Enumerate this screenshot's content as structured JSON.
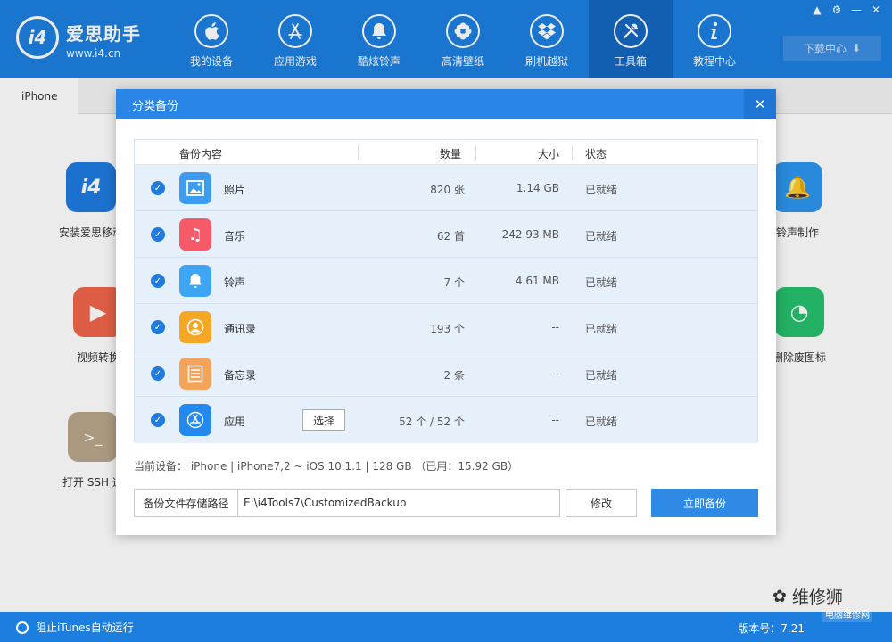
{
  "app": {
    "brand_name": "爱思助手",
    "brand_url": "www.i4.cn",
    "logo_text": "i4",
    "download_label": "下载中心"
  },
  "nav": [
    {
      "label": "我的设备",
      "icon": "apple-icon"
    },
    {
      "label": "应用游戏",
      "icon": "app-store-icon"
    },
    {
      "label": "酷炫铃声",
      "icon": "bell-icon"
    },
    {
      "label": "高清壁纸",
      "icon": "flower-icon"
    },
    {
      "label": "刷机越狱",
      "icon": "dropbox-icon"
    },
    {
      "label": "工具箱",
      "icon": "tools-icon"
    },
    {
      "label": "教程中心",
      "icon": "info-icon"
    }
  ],
  "tabs": {
    "device": "iPhone"
  },
  "background_tools": [
    {
      "label": "安装爱思移动",
      "color": "#1f7be0"
    },
    {
      "label": "视频转换",
      "color": "#f0654a"
    },
    {
      "label": "打开 SSH 通",
      "color": "#b9a58a"
    },
    {
      "label": "铃声制作",
      "color": "#2d96ee"
    },
    {
      "label": "删除废图标",
      "color": "#25c06d"
    }
  ],
  "dialog": {
    "title": "分类备份",
    "columns": {
      "content": "备份内容",
      "count": "数量",
      "size": "大小",
      "status": "状态"
    },
    "rows": [
      {
        "name": "照片",
        "count": "820 张",
        "size": "1.14 GB",
        "status": "已就绪",
        "color": "#3d9cf0",
        "icon": "photo-icon"
      },
      {
        "name": "音乐",
        "count": "62 首",
        "size": "242.93 MB",
        "status": "已就绪",
        "color": "#f65a68",
        "icon": "music-icon"
      },
      {
        "name": "铃声",
        "count": "7 个",
        "size": "4.61 MB",
        "status": "已就绪",
        "color": "#3ea4f4",
        "icon": "bell-icon"
      },
      {
        "name": "通讯录",
        "count": "193 个",
        "size": "--",
        "status": "已就绪",
        "color": "#f5a623",
        "icon": "contacts-icon"
      },
      {
        "name": "备忘录",
        "count": "2 条",
        "size": "--",
        "status": "已就绪",
        "color": "#f3a35a",
        "icon": "notes-icon"
      },
      {
        "name": "应用",
        "count": "52 个 / 52 个",
        "size": "--",
        "status": "已就绪",
        "color": "#2489ec",
        "icon": "app-store-icon",
        "select_label": "选择"
      }
    ],
    "device_info": "当前设备： iPhone   |   iPhone7,2 ~ iOS 10.1.1   |   128 GB （已用：15.92 GB）",
    "path_label": "备份文件存储路径",
    "path_value": "E:\\i4Tools7\\CustomizedBackup",
    "modify_label": "修改",
    "backup_label": "立即备份"
  },
  "statusbar": {
    "itunes_label": "阻止iTunes自动运行",
    "version": "版本号：7.21"
  },
  "watermark": {
    "text": "维修狮",
    "small": "电脑维修网"
  }
}
